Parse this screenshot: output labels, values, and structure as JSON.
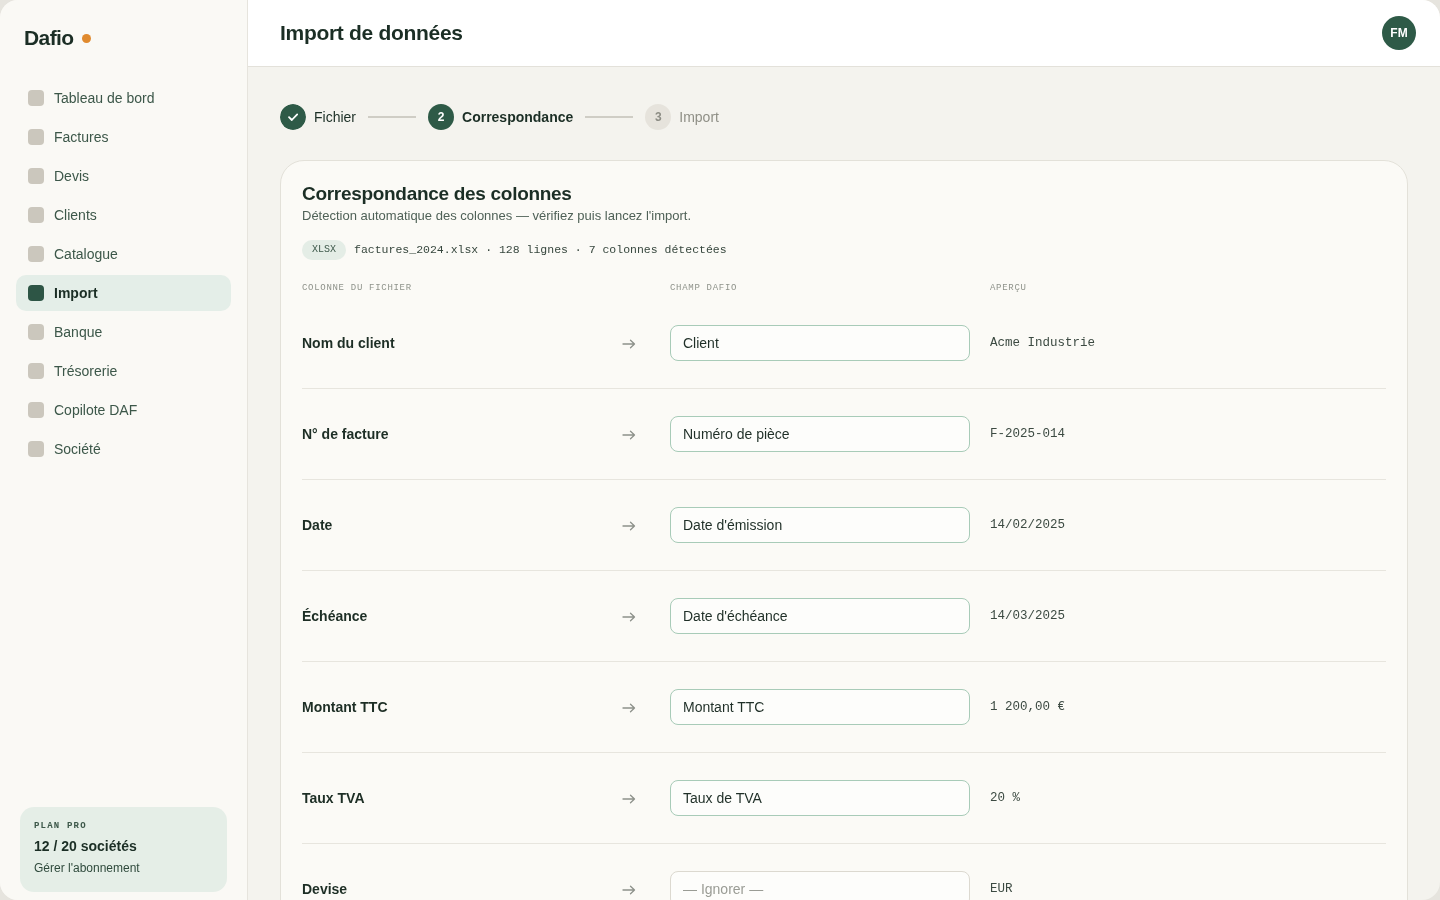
{
  "sidebar": {
    "logo": "Dafio",
    "items": [
      {
        "label": "Tableau de bord",
        "selected": false
      },
      {
        "label": "Factures",
        "selected": false
      },
      {
        "label": "Devis",
        "selected": false
      },
      {
        "label": "Clients",
        "selected": false
      },
      {
        "label": "Catalogue",
        "selected": false
      },
      {
        "label": "Import",
        "selected": true
      },
      {
        "label": "Banque",
        "selected": false
      },
      {
        "label": "Trésorerie",
        "selected": false
      },
      {
        "label": "Copilote DAF",
        "selected": false
      },
      {
        "label": "Société",
        "selected": false
      }
    ],
    "plan": {
      "label": "PLAN PRO",
      "usage": "12 / 20 sociétés",
      "link": "Gérer l'abonnement"
    }
  },
  "header": {
    "title": "Import de données",
    "avatar": "FM"
  },
  "stepper": [
    {
      "done": true,
      "current": false,
      "label": "Fichier"
    },
    {
      "done": false,
      "current": true,
      "number": "2",
      "label": "Correspondance"
    },
    {
      "done": false,
      "current": false,
      "number": "3",
      "label": "Import"
    }
  ],
  "mapping_card": {
    "title": "Correspondance des colonnes",
    "subtitle": "Détection automatique des colonnes — vérifiez puis lancez l'import.",
    "file": {
      "format": "XLSX",
      "summary": "factures_2024.xlsx · 128 lignes · 7 colonnes détectées"
    },
    "columns": [
      "COLONNE DU FICHIER",
      "CHAMP DAFIO",
      "APERÇU"
    ],
    "rows": [
      {
        "source": "Nom du client",
        "field": {
          "value": "Client"
        },
        "preview": "Acme Industrie"
      },
      {
        "source": "N° de facture",
        "field": {
          "value": "Numéro de pièce"
        },
        "preview": "F-2025-014"
      },
      {
        "source": "Date",
        "field": {
          "value": "Date d'émission"
        },
        "preview": "14/02/2025"
      },
      {
        "source": "Échéance",
        "field": {
          "value": "Date d'échéance"
        },
        "preview": "14/03/2025"
      },
      {
        "source": "Montant TTC",
        "field": {
          "value": "Montant TTC"
        },
        "preview": "1 200,00 €"
      },
      {
        "source": "Taux TVA",
        "field": {
          "value": "Taux de TVA"
        },
        "preview": "20 %"
      },
      {
        "source": "Devise",
        "field": {
          "placeholder": "— Ignorer —"
        },
        "preview": "EUR"
      }
    ]
  }
}
